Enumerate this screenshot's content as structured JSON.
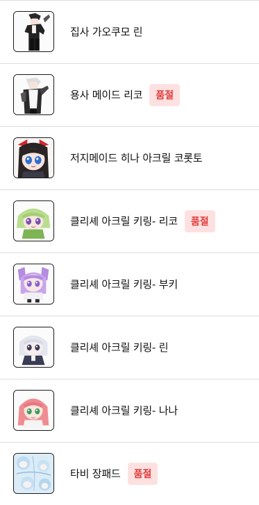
{
  "products": [
    {
      "title": "집사 가오쿠모 린",
      "soldout": ""
    },
    {
      "title": "용사 메이드 리코",
      "soldout": "품절"
    },
    {
      "title": "저지메이드 히나 아크릴 코롯토",
      "soldout": ""
    },
    {
      "title": "클리셰 아크릴 키링- 리코",
      "soldout": "품절"
    },
    {
      "title": "클리셰 아크릴 키링- 부키",
      "soldout": ""
    },
    {
      "title": "클리셰 아크릴 키링- 린",
      "soldout": ""
    },
    {
      "title": "클리셰 아크릴 키링- 나나",
      "soldout": ""
    },
    {
      "title": "타비 장패드",
      "soldout": "품절"
    }
  ],
  "thumbnail_icons": [
    "butler-rin-figure-icon",
    "hero-maid-riko-figure-icon",
    "jersey-maid-hina-figure-icon",
    "riko-keyring-icon",
    "buki-keyring-icon",
    "rin-keyring-icon",
    "nana-keyring-icon",
    "tabi-mousepad-icon"
  ],
  "colors": {
    "badge_bg": "#fde1e1",
    "badge_text": "#e03a3a",
    "divider": "#dcdcdc",
    "thumb_border": "#1a1a1a"
  }
}
